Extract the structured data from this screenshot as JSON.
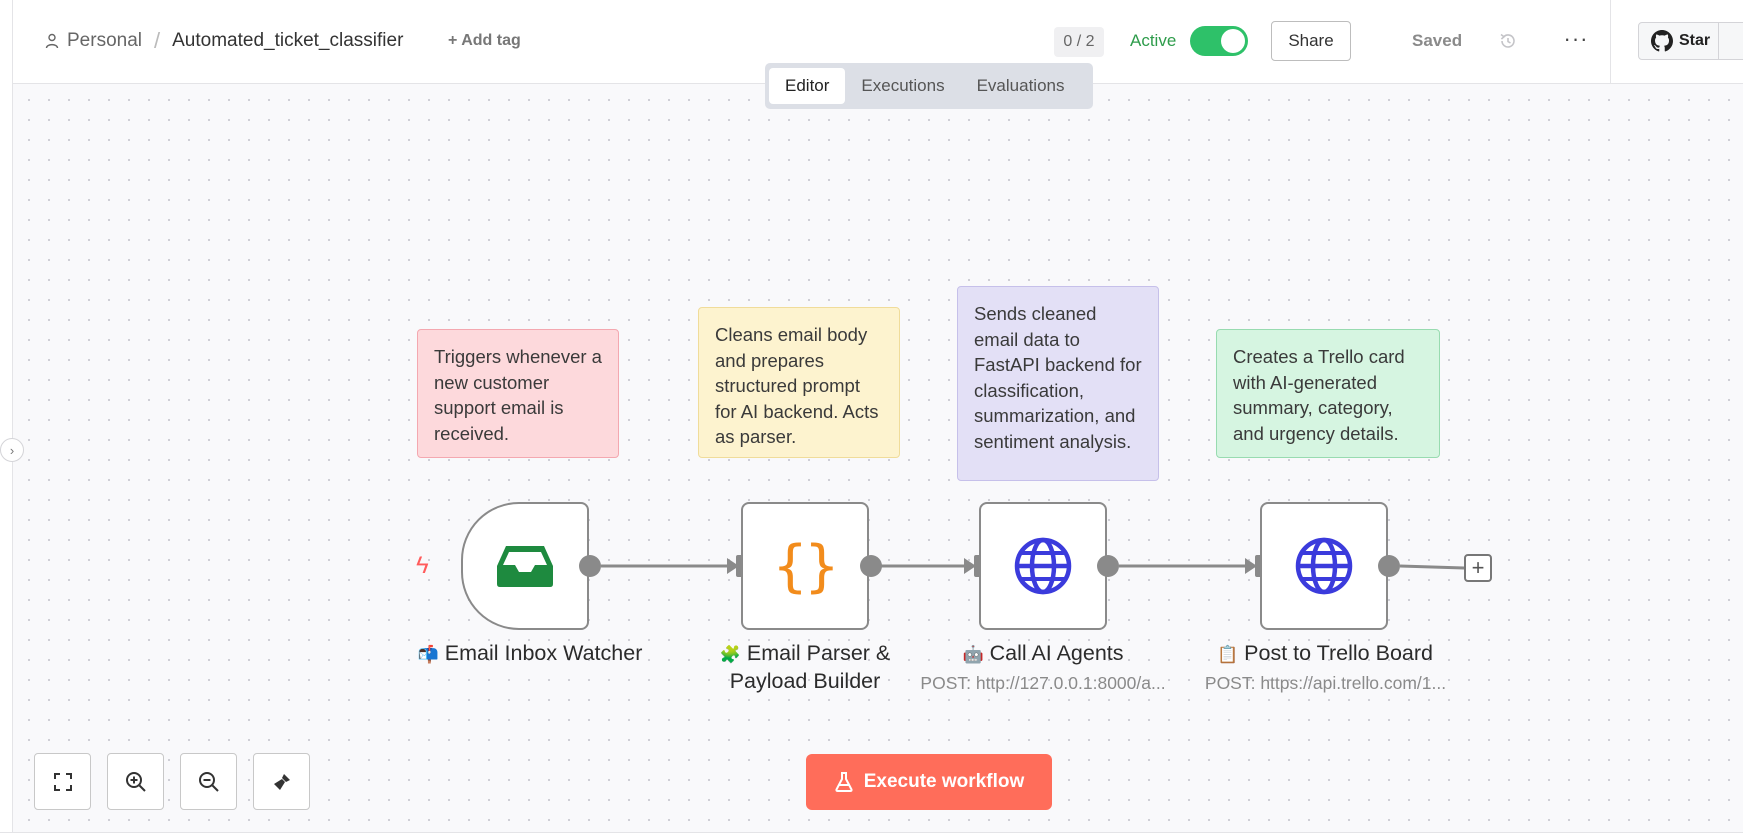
{
  "header": {
    "project": "Personal",
    "workflow_name": "Automated_ticket_classifier",
    "add_tag": "+ Add tag",
    "counter": "0 / 2",
    "active_label": "Active",
    "active": true,
    "share": "Share",
    "saved": "Saved",
    "more": "···",
    "star": "Star"
  },
  "tabs": [
    {
      "label": "Editor",
      "active": true
    },
    {
      "label": "Executions",
      "active": false
    },
    {
      "label": "Evaluations",
      "active": false
    }
  ],
  "stickies": {
    "trigger": "Triggers whenever a new customer support email is received.",
    "parser": "Cleans email body and prepares structured prompt for AI backend. Acts as parser.",
    "ai": "Sends cleaned email data to FastAPI backend for classification, summarization, and sentiment analysis.",
    "trello": "Creates a Trello card with AI-generated summary, category, and urgency details."
  },
  "nodes": {
    "trigger": {
      "emoji": "📬",
      "name": "Email Inbox Watcher",
      "icon": "inbox-icon"
    },
    "parser": {
      "emoji": "🧩",
      "name_line1": "Email Parser &",
      "name_line2": "Payload Builder",
      "icon": "braces-icon"
    },
    "ai": {
      "emoji": "🤖",
      "name": "Call AI Agents",
      "subtitle": "POST: http://127.0.0.1:8000/a...",
      "icon": "globe-icon"
    },
    "trello": {
      "emoji": "📋",
      "name": "Post to Trello Board",
      "subtitle": "POST: https://api.trello.com/1...",
      "icon": "globe-icon"
    }
  },
  "controls": {
    "execute": "Execute workflow"
  },
  "colors": {
    "accent": "#ff6d5a",
    "active_green": "#2ec169",
    "inbox_green": "#1e8a3f",
    "braces_orange": "#f28c1c",
    "globe_blue": "#3b3bdc"
  }
}
